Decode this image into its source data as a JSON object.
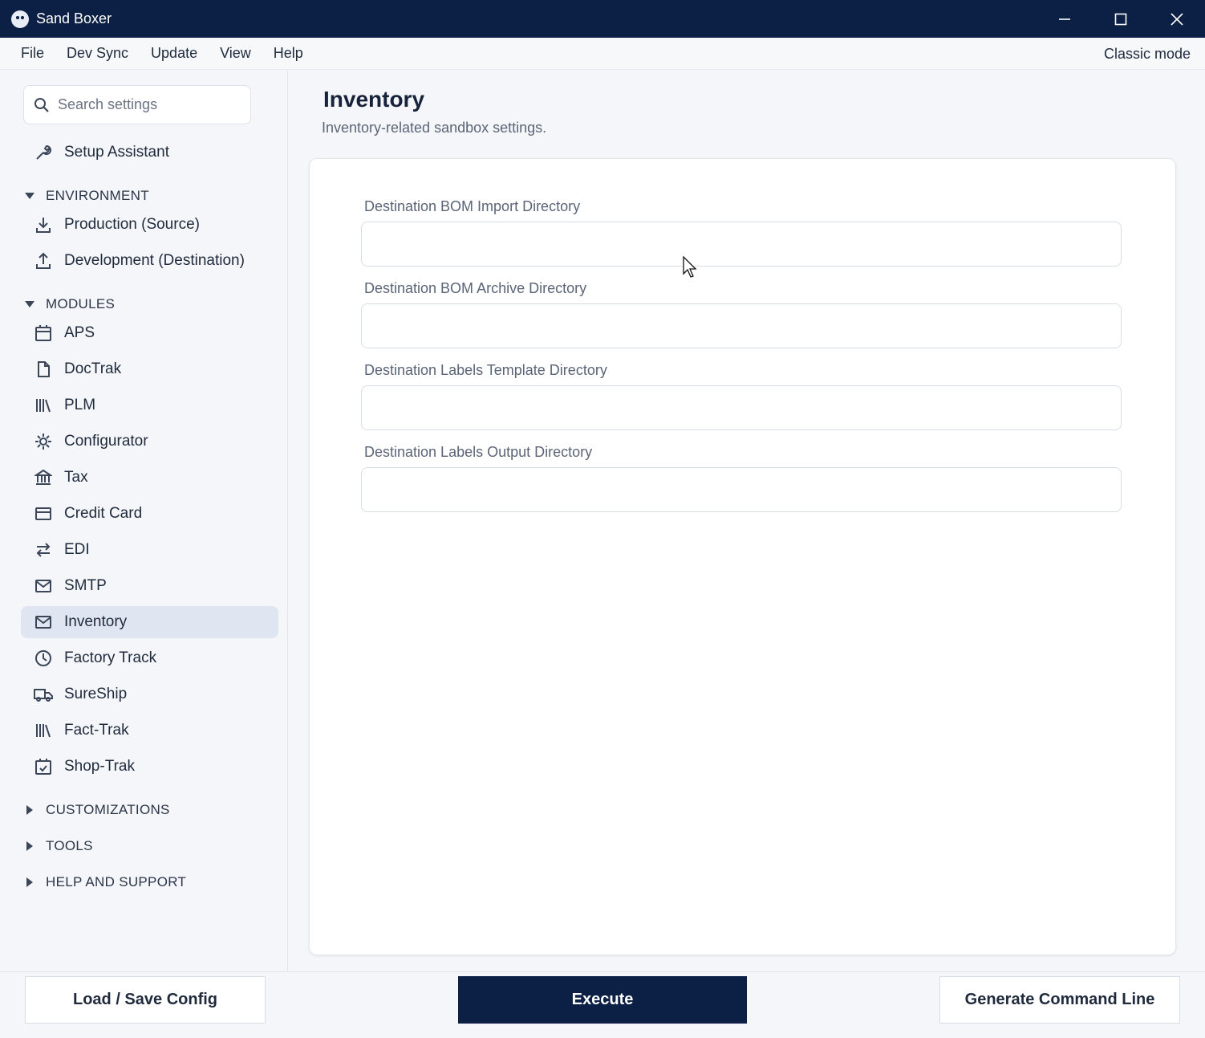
{
  "window": {
    "title": "Sand Boxer"
  },
  "menu": {
    "items": [
      "File",
      "Dev Sync",
      "Update",
      "View",
      "Help"
    ],
    "classic_mode": "Classic mode"
  },
  "sidebar": {
    "search_placeholder": "Search settings",
    "setup": "Setup Assistant",
    "environment": {
      "label": "ENVIRONMENT",
      "items": [
        {
          "label": "Production (Source)",
          "icon": "download-icon"
        },
        {
          "label": "Development (Destination)",
          "icon": "upload-icon"
        }
      ]
    },
    "modules": {
      "label": "MODULES",
      "items": [
        {
          "label": "APS",
          "icon": "calendar-icon"
        },
        {
          "label": "DocTrak",
          "icon": "document-icon"
        },
        {
          "label": "PLM",
          "icon": "library-icon"
        },
        {
          "label": "Configurator",
          "icon": "gear-icon"
        },
        {
          "label": "Tax",
          "icon": "bank-icon"
        },
        {
          "label": "Credit Card",
          "icon": "credit-card-icon"
        },
        {
          "label": "EDI",
          "icon": "swap-icon"
        },
        {
          "label": "SMTP",
          "icon": "mail-icon"
        },
        {
          "label": "Inventory",
          "icon": "mail-icon"
        },
        {
          "label": "Factory Track",
          "icon": "clock-icon"
        },
        {
          "label": "SureShip",
          "icon": "truck-icon"
        },
        {
          "label": "Fact-Trak",
          "icon": "library-icon"
        },
        {
          "label": "Shop-Trak",
          "icon": "calendar-check-icon"
        }
      ]
    },
    "collapsed_sections": [
      "CUSTOMIZATIONS",
      "TOOLS",
      "HELP AND SUPPORT"
    ]
  },
  "main": {
    "title": "Inventory",
    "subtitle": "Inventory-related sandbox settings.",
    "fields": [
      {
        "label": "Destination BOM Import Directory",
        "value": ""
      },
      {
        "label": "Destination BOM Archive Directory",
        "value": ""
      },
      {
        "label": "Destination Labels Template Directory",
        "value": ""
      },
      {
        "label": "Destination Labels Output Directory",
        "value": ""
      }
    ]
  },
  "footer": {
    "load_save": "Load / Save Config",
    "execute": "Execute",
    "generate": "Generate Command Line"
  },
  "colors": {
    "titlebar": "#0c1f44",
    "active_item": "#dfe6f1",
    "primary_button": "#0c1f44"
  }
}
